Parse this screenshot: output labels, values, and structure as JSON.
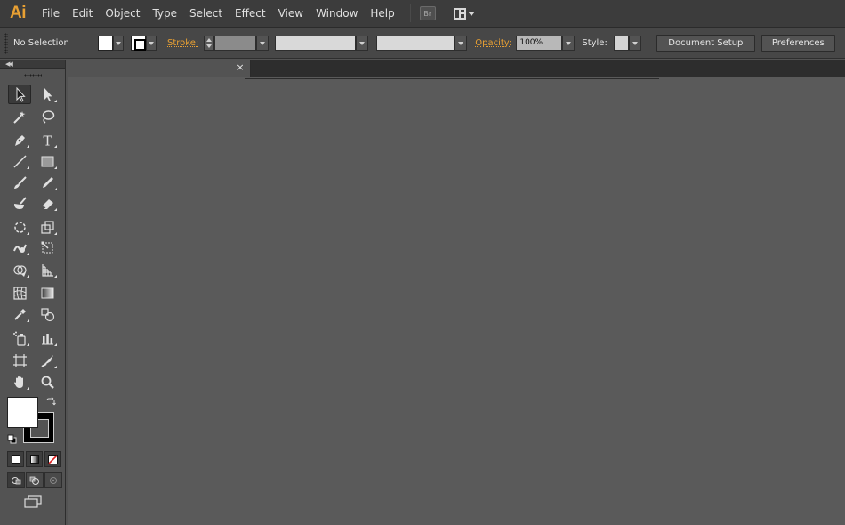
{
  "app": {
    "logo": "Ai"
  },
  "menu": {
    "items": [
      "File",
      "Edit",
      "Object",
      "Type",
      "Select",
      "Effect",
      "View",
      "Window",
      "Help"
    ],
    "bridge_label": "Br"
  },
  "control": {
    "selection_status": "No Selection",
    "stroke_label": "Stroke:",
    "opacity_label": "Opacity:",
    "opacity_value": "100%",
    "style_label": "Style:",
    "document_setup_label": "Document Setup",
    "preferences_label": "Preferences"
  },
  "document": {
    "close_glyph": "×"
  },
  "tools": [
    "selection-tool",
    "direct-selection-tool",
    "magic-wand-tool",
    "lasso-tool",
    "pen-tool",
    "type-tool",
    "line-segment-tool",
    "rectangle-tool",
    "paintbrush-tool",
    "pencil-tool",
    "blob-brush-tool",
    "eraser-tool",
    "rotate-tool",
    "scale-tool",
    "warp-tool",
    "free-transform-tool",
    "shape-builder-tool",
    "graph-tool",
    "mesh-tool",
    "gradient-tool",
    "eyedropper-tool",
    "blend-tool",
    "symbol-sprayer-tool",
    "column-graph-tool",
    "artboard-tool",
    "slice-tool",
    "hand-tool",
    "zoom-tool"
  ],
  "colors": {
    "fill": "#ffffff",
    "stroke": "#000000",
    "accent": "#e8a033"
  }
}
